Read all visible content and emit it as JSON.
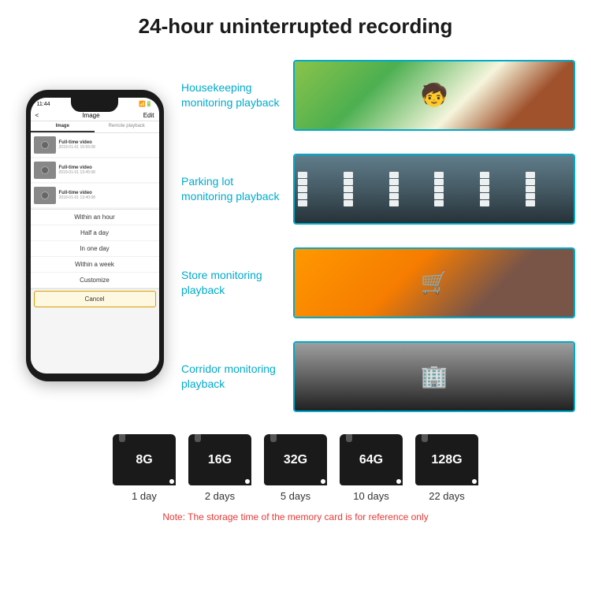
{
  "header": {
    "title": "24-hour uninterrupted recording"
  },
  "phone": {
    "time": "11:44",
    "screen_title": "Image",
    "edit_label": "Edit",
    "back_label": "<",
    "tabs": [
      "Image",
      "Remote playback"
    ],
    "list_items": [
      {
        "title": "Full-time video",
        "date": "2019-01-01 15:55:08"
      },
      {
        "title": "Full-time video",
        "date": "2019-01-01 13:45:08"
      },
      {
        "title": "Full-time video",
        "date": "2019-01-01 13:40:08"
      }
    ],
    "dropdown_items": [
      "Within an hour",
      "Half a day",
      "In one day",
      "Within a week",
      "Customize"
    ],
    "cancel_label": "Cancel"
  },
  "monitoring": {
    "items": [
      {
        "label": "Housekeeping\nmonitoring playback",
        "type": "housekeeping"
      },
      {
        "label": "Parking lot\nmonitoring playback",
        "type": "parking"
      },
      {
        "label": "Store monitoring\nplayback",
        "type": "store"
      },
      {
        "label": "Corridor monitoring\nplayback",
        "type": "corridor"
      }
    ]
  },
  "storage": {
    "cards": [
      {
        "size": "8G",
        "days": "1 day"
      },
      {
        "size": "16G",
        "days": "2 days"
      },
      {
        "size": "32G",
        "days": "5 days"
      },
      {
        "size": "64G",
        "days": "10 days"
      },
      {
        "size": "128G",
        "days": "22 days"
      }
    ],
    "note": "Note: The storage time of the memory card is for reference only"
  }
}
